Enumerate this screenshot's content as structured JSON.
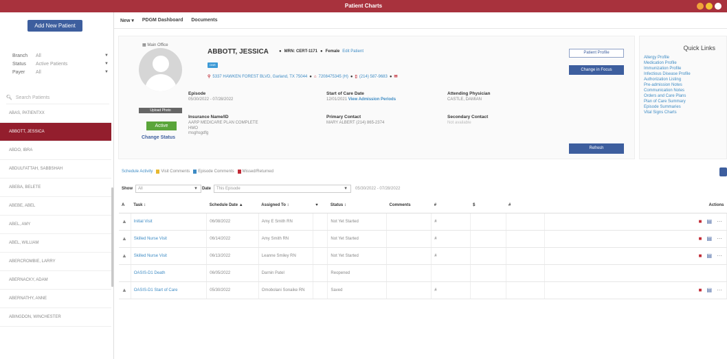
{
  "window": {
    "title": "Patient Charts"
  },
  "sidebar": {
    "add_button": "Add New Patient",
    "filters": [
      {
        "label": "Branch",
        "value": "All"
      },
      {
        "label": "Status",
        "value": "Active Patients"
      },
      {
        "label": "Payer",
        "value": "All"
      }
    ],
    "search_placeholder": "Search Patients",
    "patients": [
      "ABAS, PATIENTXX",
      "ABBOTT, JESSICA",
      "ABDO, IBRA",
      "ABDULFATTAH, SABBSHAH",
      "ABEBA, BELETE",
      "ABEBE, ABEL",
      "ABEL, AMY",
      "ABEL, WILLIAM",
      "ABERCROMBIE, LARRY",
      "ABERNACKY, ADAM",
      "ABERNATHY, ANNE",
      "ABINGDON, WINCHESTER"
    ],
    "active_patient": "ABBOTT, JESSICA"
  },
  "topnav": {
    "items": [
      "New ▾",
      "PDGM Dashboard",
      "Documents"
    ]
  },
  "patient": {
    "office": "Main Office",
    "name": "ABBOTT, JESSICA",
    "mrn_label": "MRN: CERT-1171",
    "gender": "Female",
    "edit_label": "Edit Patient",
    "tag": "DNR",
    "address": "5337 HAWKEN FOREST BLVD, Garland, TX 75044",
    "phone1": "7208475345 (H)",
    "phone2": "(214) 587-9683",
    "avatar_bar": "Upload Photo",
    "status": "Active",
    "change_status": "Change Status",
    "episode_label": "Episode",
    "episode_value": "05/30/2022 - 07/28/2022",
    "soc_label": "Start of Care Date",
    "soc_value": "12/01/2021",
    "soc_link": "View Admission Periods",
    "attending_label": "Attending Physician",
    "attending_value": "CASTLE, DAMIAN",
    "insurance_label": "Insurance Name/ID",
    "insurance_value": "AARP MEDICARE PLAN COMPLETE",
    "insurance_line2": "HMO",
    "insurance_line3": "msghsgdfg",
    "primary_label": "Primary Contact",
    "primary_value": "MARY ALBERT (214) 865-2374",
    "secondary_label": "Secondary Contact",
    "secondary_value": "Not available",
    "btn_profile": "Patient Profile",
    "btn_focus": "Change in Focus",
    "btn_refresh": "Refresh"
  },
  "quick_links": {
    "title": "Quick Links",
    "items": [
      "Allergy Profile",
      "Medication Profile",
      "Immunization Profile",
      "Infectious Disease Profile",
      "Authorization Listing",
      "Pre-admission Notes",
      "Communication Notes",
      "Orders and Care Plans",
      "Plan of Care Summary",
      "Episode Summaries",
      "Vital Signs Charts"
    ]
  },
  "legend": {
    "schedule": "Schedule Activity",
    "visit": "Visit Comments",
    "episode": "Episode Comments",
    "missed": "Missed/Returned"
  },
  "filters2": {
    "show_label": "Show",
    "show_value": "All",
    "date_label": "Date",
    "date_value": "This Episode",
    "range": "05/30/2022 - 07/28/2022"
  },
  "table": {
    "headers": [
      "A",
      "Task",
      "Schedule Date",
      "Assigned To",
      "♥",
      "Status",
      "Comments",
      "#",
      "$",
      "#",
      "Actions"
    ],
    "rows": [
      {
        "alert": true,
        "task": "Initial Visit",
        "date": "06/08/2022",
        "assigned": "Amy E Smith RN",
        "status": "Not Yet Started",
        "hash": true
      },
      {
        "alert": true,
        "task": "Skilled Nurse Visit",
        "date": "06/14/2022",
        "assigned": "Amy Smith RN",
        "status": "Not Yet Started",
        "hash": true
      },
      {
        "alert": true,
        "task": "Skilled Nurse Visit",
        "date": "06/13/2022",
        "assigned": "Leanne Smiley RN",
        "status": "Not Yet Started",
        "hash": true
      },
      {
        "alert": false,
        "task": "OASIS-D1 Death",
        "date": "06/05/2022",
        "assigned": "Darnin Patel",
        "status": "Reopened",
        "hash": false
      },
      {
        "alert": true,
        "task": "OASIS-D1 Start of Care",
        "date": "05/30/2022",
        "assigned": "Omobolani Sonaike RN",
        "status": "Saved",
        "hash": true
      }
    ]
  }
}
